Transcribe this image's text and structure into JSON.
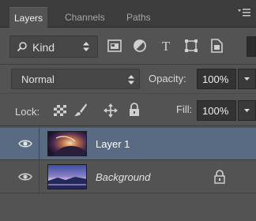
{
  "tabs": [
    {
      "label": "Layers"
    },
    {
      "label": "Channels"
    },
    {
      "label": "Paths"
    }
  ],
  "panel_menu_icon": "panel-menu-icon",
  "filter": {
    "kind_label": "Kind",
    "icons": [
      "pixel-filter-icon",
      "adjustment-filter-icon",
      "type-filter-icon",
      "shape-filter-icon",
      "smart-object-filter-icon"
    ]
  },
  "blend": {
    "mode": "Normal",
    "opacity_label": "Opacity:",
    "opacity_value": "100%"
  },
  "lock": {
    "label": "Lock:",
    "icons": [
      "lock-transparent-pixels-icon",
      "lock-image-pixels-icon",
      "lock-position-icon",
      "lock-all-icon"
    ],
    "fill_label": "Fill:",
    "fill_value": "100%"
  },
  "layers": [
    {
      "name": "Layer 1",
      "selected": true,
      "locked": false
    },
    {
      "name": "Background",
      "selected": false,
      "locked": true
    }
  ],
  "colors": {
    "panel_bg": "#535353",
    "tabbar_bg": "#3c3c3c",
    "selection": "#586b83"
  }
}
